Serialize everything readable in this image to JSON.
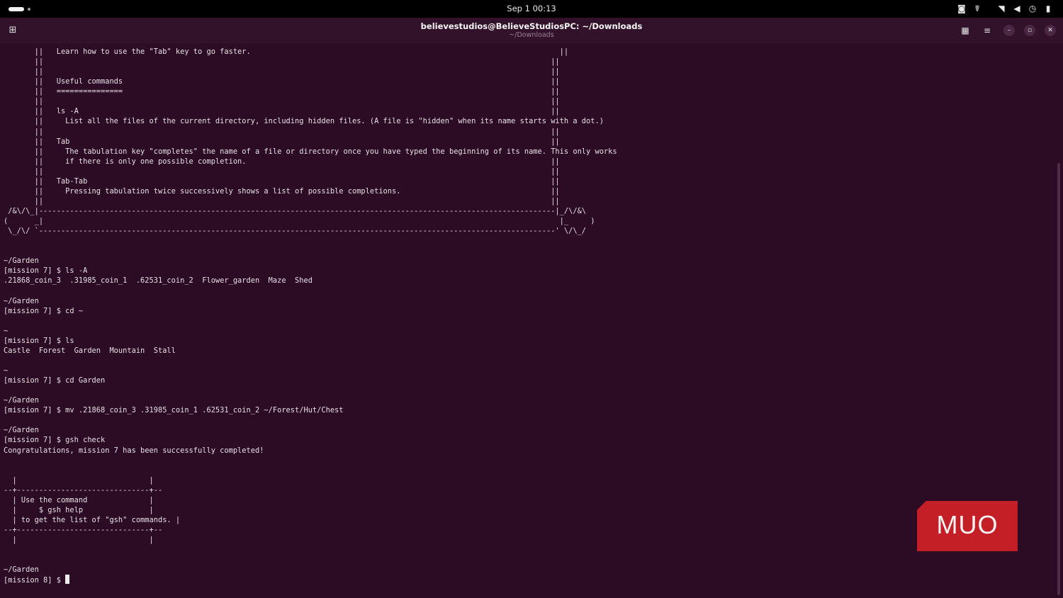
{
  "system_bar": {
    "clock": "Sep 1  00:13",
    "tray_icons": [
      "screen-record-icon",
      "accessibility-icon",
      "wifi-icon",
      "volume-icon",
      "power-profile-icon",
      "battery-icon"
    ]
  },
  "window": {
    "title": "believestudios@BelieveStudiosPC: ~/Downloads",
    "subtitle": "~/Downloads",
    "controls": [
      "view-tabs-icon",
      "menu-icon",
      "minimize-icon",
      "maximize-icon",
      "close-icon"
    ]
  },
  "terminal": {
    "lines": [
      "       ||   Learn how to use the \"Tab\" key to go faster.                                                                      ||",
      "       ||                                                                                                                   ||",
      "       ||                                                                                                                   ||",
      "       ||   Useful commands                                                                                                 ||",
      "       ||   ===============                                                                                                 ||",
      "       ||                                                                                                                   ||",
      "       ||   ls -A                                                                                                           ||",
      "       ||     List all the files of the current directory, including hidden files. (A file is \"hidden\" when its name starts with a dot.)",
      "       ||                                                                                                                   ||",
      "       ||   Tab                                                                                                             ||",
      "       ||     The tabulation key \"completes\" the name of a file or directory once you have typed the beginning of its name. This only works",
      "       ||     if there is only one possible completion.                                                                     ||",
      "       ||                                                                                                                   ||",
      "       ||   Tab-Tab                                                                                                         ||",
      "       ||     Pressing tabulation twice successively shows a list of possible completions.                                  ||",
      "       ||                                                                                                                   ||",
      " /&\\/\\_|---------------------------------------------------------------------------------------------------------------------|_/\\/&\\",
      "(      _|                                                                                                                     |_     )",
      " \\_/\\/ `---------------------------------------------------------------------------------------------------------------------' \\/\\_/",
      "",
      "",
      "~/Garden",
      "[mission 7] $ ls -A",
      ".21868_coin_3  .31985_coin_1  .62531_coin_2  Flower_garden  Maze  Shed",
      "",
      "~/Garden",
      "[mission 7] $ cd ~",
      "",
      "~",
      "[mission 7] $ ls",
      "Castle  Forest  Garden  Mountain  Stall",
      "",
      "~",
      "[mission 7] $ cd Garden",
      "",
      "~/Garden",
      "[mission 7] $ mv .21868_coin_3 .31985_coin_1 .62531_coin_2 ~/Forest/Hut/Chest",
      "",
      "~/Garden",
      "[mission 7] $ gsh check",
      ""
    ],
    "success_message": "Congratulations, mission 7 has been successfully completed!",
    "help_box": [
      "",
      "",
      "  |                              |",
      "--+------------------------------+--",
      "  | Use the command              |",
      "  |     $ gsh help               |",
      "  | to get the list of \"gsh\" commands. |",
      "--+------------------------------+--",
      "  |                              |",
      "",
      "",
      "~/Garden"
    ],
    "prompt": "[mission 8] $ "
  },
  "watermark": {
    "text": "MUO",
    "color": "#c41e26"
  }
}
